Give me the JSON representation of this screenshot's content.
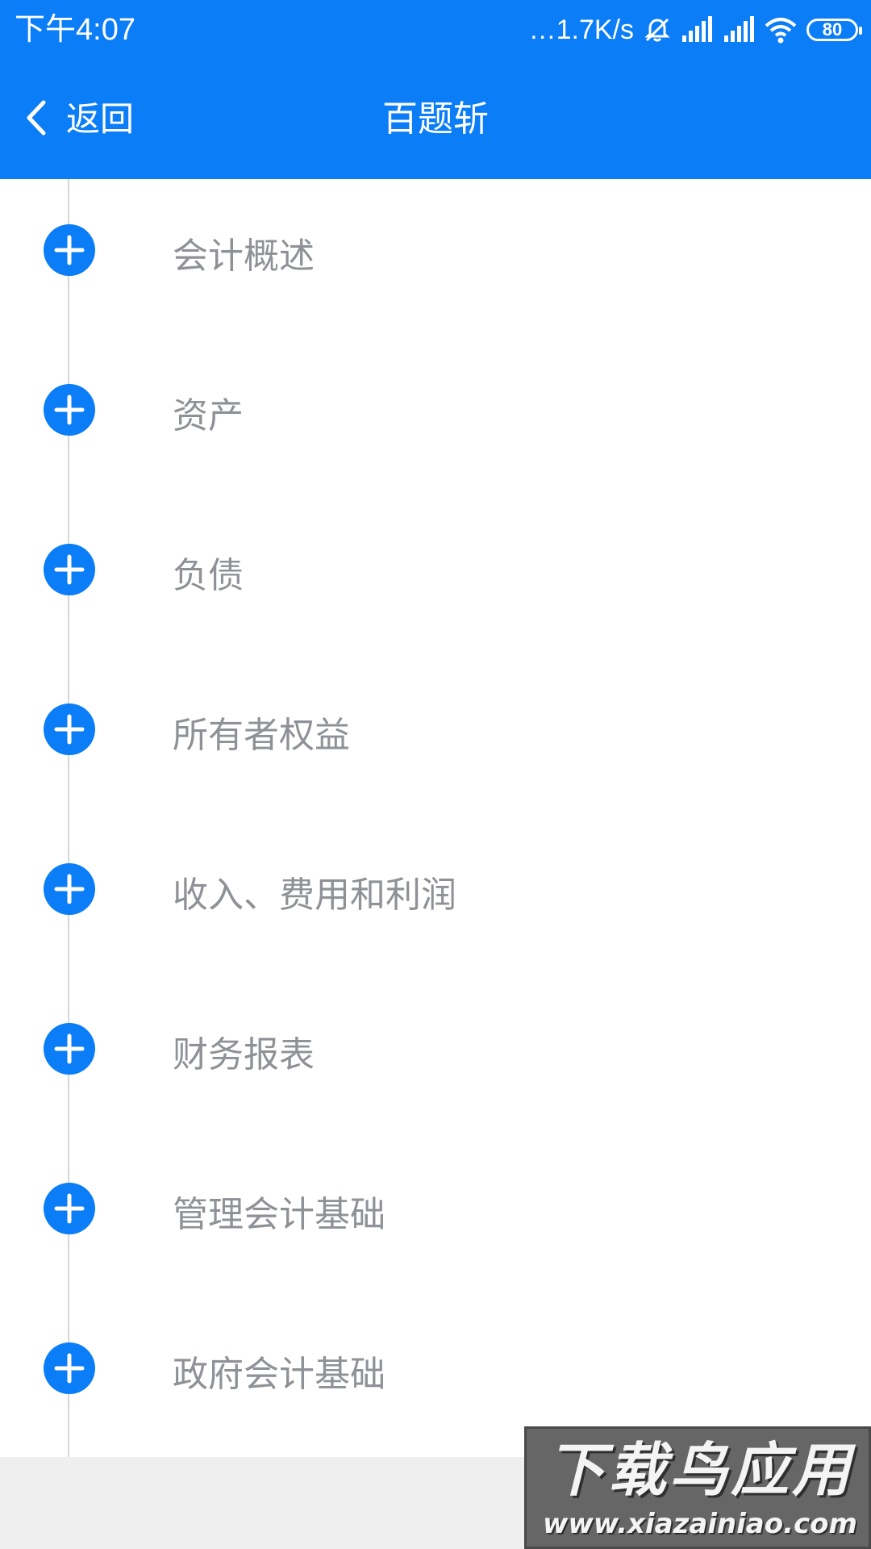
{
  "status_bar": {
    "time": "下午4:07",
    "net_speed": "…1.7K/s",
    "battery": "80",
    "icons": [
      "alarm-off-icon",
      "signal-icon",
      "signal-icon",
      "wifi-icon",
      "battery-icon"
    ]
  },
  "header": {
    "back_label": "返回",
    "title": "百题斩"
  },
  "chapters": [
    {
      "label": "会计概述"
    },
    {
      "label": "资产"
    },
    {
      "label": "负债"
    },
    {
      "label": "所有者权益"
    },
    {
      "label": "收入、费用和利润"
    },
    {
      "label": "财务报表"
    },
    {
      "label": "管理会计基础"
    },
    {
      "label": "政府会计基础"
    }
  ],
  "watermark": {
    "title": "下载鸟应用",
    "url": "www.xiazainiao.com"
  },
  "colors": {
    "accent": "#0a7df7",
    "label_text": "#8e9196",
    "timeline": "#d7d7d7"
  }
}
